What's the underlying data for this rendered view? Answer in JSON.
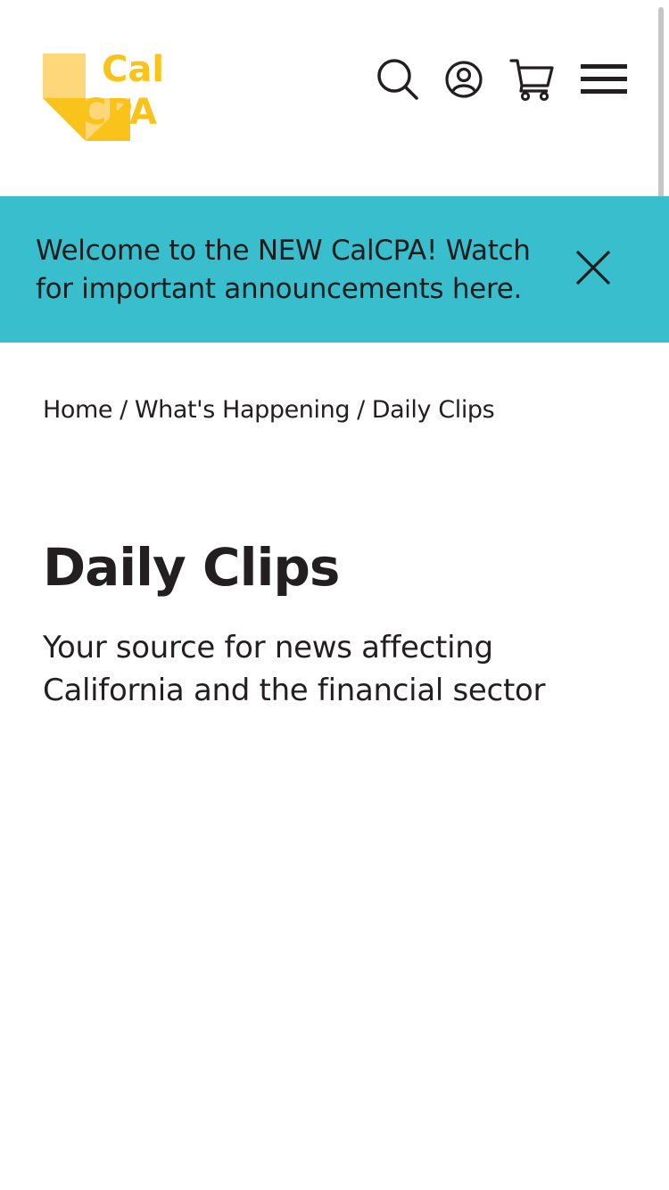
{
  "header": {
    "logo": {
      "line1": "Cal",
      "line2": "CPA"
    },
    "icons": {
      "search": "search-icon",
      "account": "user-circle-icon",
      "cart": "cart-icon",
      "menu": "hamburger-menu-icon"
    }
  },
  "banner": {
    "text": "Welcome to the NEW CalCPA! Watch for important announcements here.",
    "close_icon": "close-icon"
  },
  "breadcrumb": {
    "items": [
      "Home",
      "What's Happening",
      "Daily Clips"
    ],
    "separator": "/"
  },
  "main": {
    "title": "Daily Clips",
    "subtitle": "Your source for news affecting California and the financial sector"
  },
  "colors": {
    "brand_yellow": "#f9c31c",
    "brand_yellow_light": "#fdd77a",
    "banner_bg": "#39becd",
    "text": "#231f20"
  }
}
